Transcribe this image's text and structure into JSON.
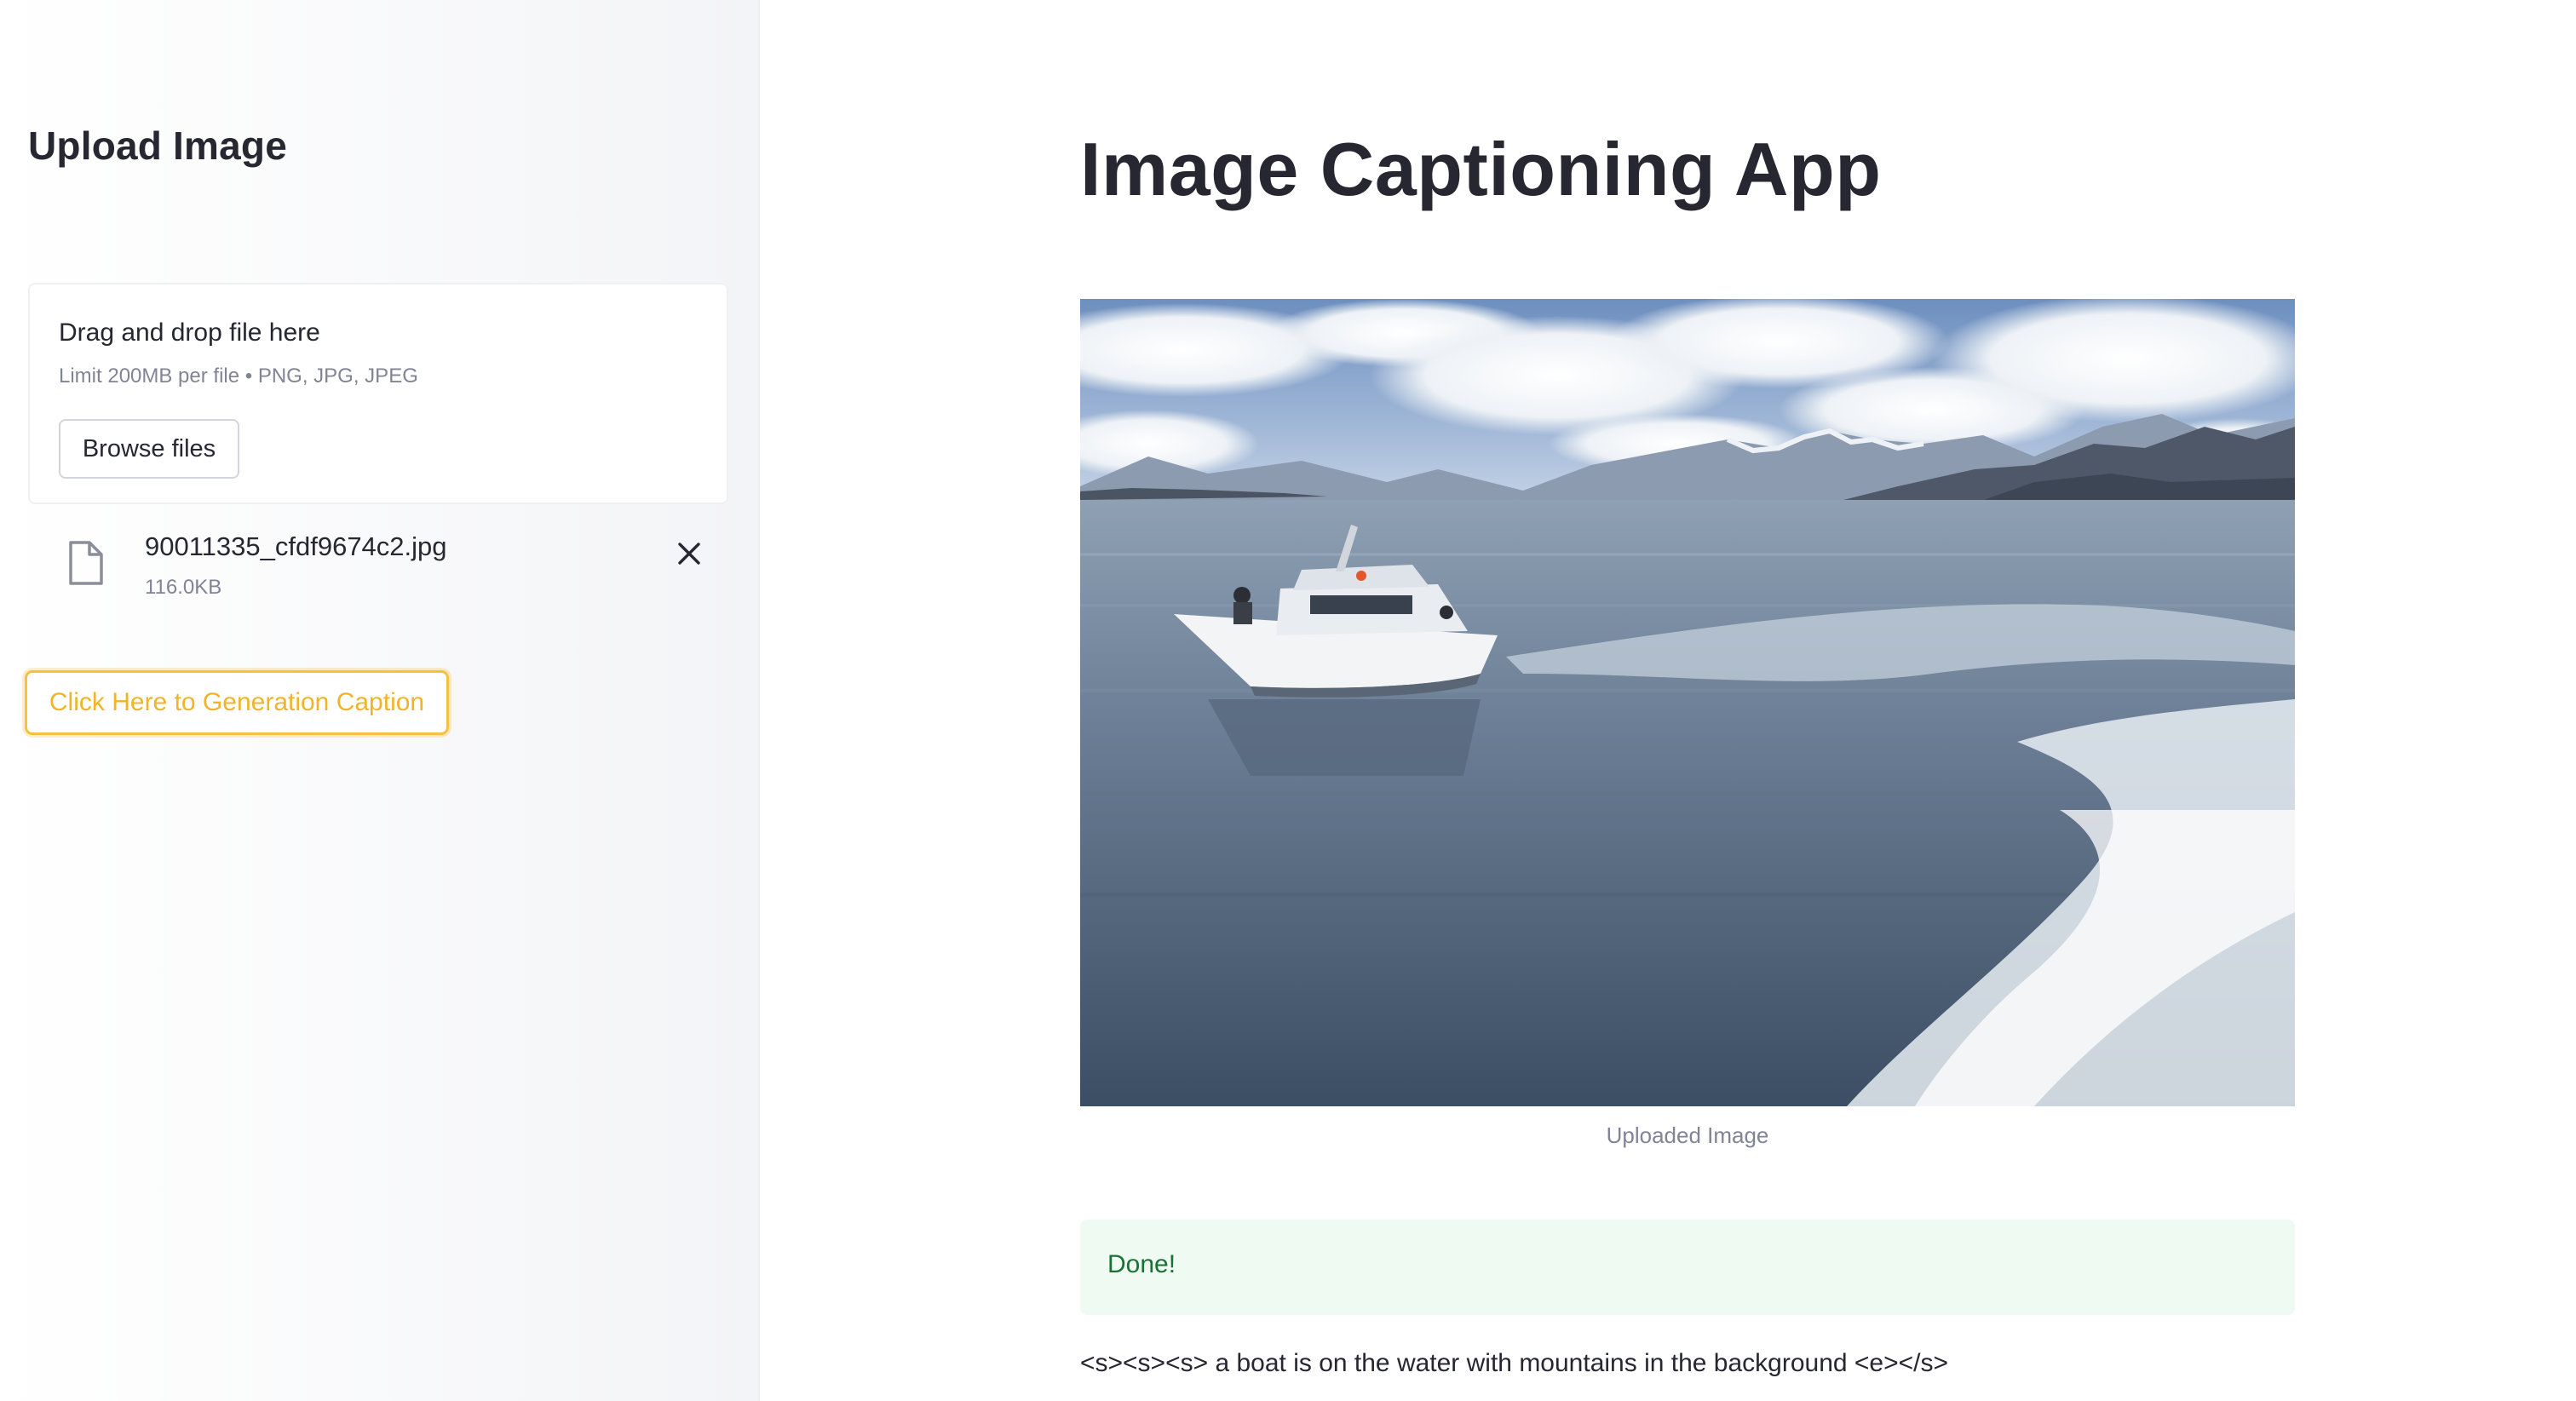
{
  "sidebar": {
    "title": "Upload Image",
    "uploader": {
      "drag_text": "Drag and drop file here",
      "limit_text": "Limit 200MB per file • PNG, JPG, JPEG",
      "browse_label": "Browse files"
    },
    "file": {
      "name": "90011335_cfdf9674c2.jpg",
      "size": "116.0KB",
      "icon": "file-icon",
      "remove_icon": "close-icon"
    },
    "generate_label": "Click Here to Generation Caption"
  },
  "main": {
    "title": "Image Captioning App",
    "image_caption": "Uploaded Image",
    "status_text": "Done!",
    "generated_caption": "<s><s><s> a boat is on the water with mountains in the background <e></s>"
  },
  "colors": {
    "accent": "#f6c142",
    "success_bg": "#effaf3",
    "success_text": "#177233",
    "sidebar_bg": "#f3f4f7",
    "text": "#262730",
    "muted": "#808495"
  }
}
